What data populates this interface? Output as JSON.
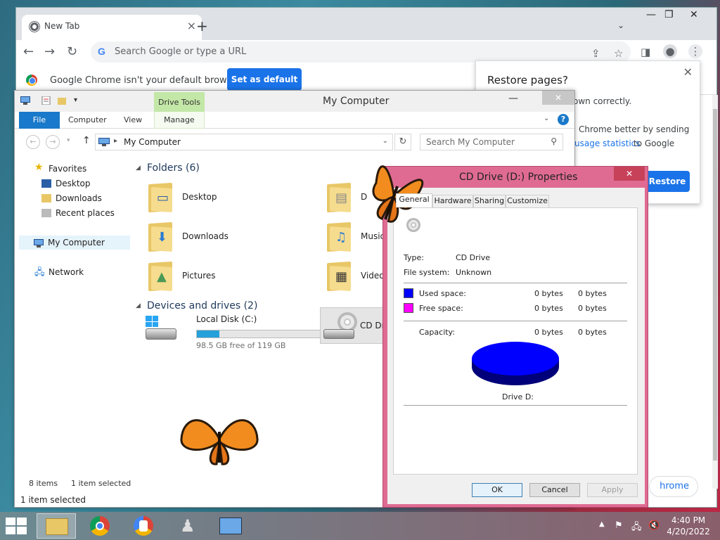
{
  "chrome": {
    "tab_title": "New Tab",
    "omnibox_placeholder": "Search Google or type a URL",
    "infobar_text": "Google Chrome isn't your default browser",
    "set_default_label": "Set as default",
    "restore": {
      "title": "Restore pages?",
      "line1": "own correctly.",
      "line2": "Chrome better by sending",
      "link": "usage statistics",
      "to_google": "to Google",
      "button": "Restore"
    },
    "customize_label": "hrome"
  },
  "explorer": {
    "title": "My Computer",
    "drive_tools": "Drive Tools",
    "ribbon_tabs": [
      "File",
      "Computer",
      "View",
      "Manage"
    ],
    "address": "My Computer",
    "search_placeholder": "Search My Computer",
    "nav": {
      "favorites": "Favorites",
      "desktop": "Desktop",
      "downloads": "Downloads",
      "recent": "Recent places",
      "my_computer": "My Computer",
      "network": "Network"
    },
    "folders_header": "Folders (6)",
    "folders": [
      "Desktop",
      "Downloads",
      "Pictures",
      "D",
      "Music",
      "Videos"
    ],
    "devices_header": "Devices and drives (2)",
    "local_disk": {
      "name": "Local Disk (C:)",
      "free_text": "98.5 GB free of 119 GB",
      "used_fraction": 0.17
    },
    "cd_drive_label": "CD Dri",
    "status_items": "8 items",
    "status_selected": "1 item selected",
    "status_bottom": "1 item selected"
  },
  "props": {
    "title": "CD Drive (D:) Properties",
    "tabs": [
      "General",
      "Hardware",
      "Sharing",
      "Customize"
    ],
    "type_label": "Type:",
    "type_value": "CD Drive",
    "fs_label": "File system:",
    "fs_value": "Unknown",
    "used_label": "Used space:",
    "used_bytes": "0 bytes",
    "used_bytes2": "0 bytes",
    "free_label": "Free space:",
    "free_bytes": "0 bytes",
    "free_bytes2": "0 bytes",
    "capacity_label": "Capacity:",
    "capacity_bytes": "0 bytes",
    "capacity_bytes2": "0 bytes",
    "drive_label": "Drive D:",
    "ok": "OK",
    "cancel": "Cancel",
    "apply": "Apply",
    "colors": {
      "used": "#0000ff",
      "free": "#ff00ff"
    }
  },
  "taskbar": {
    "time": "4:40 PM",
    "date": "4/20/2022"
  }
}
